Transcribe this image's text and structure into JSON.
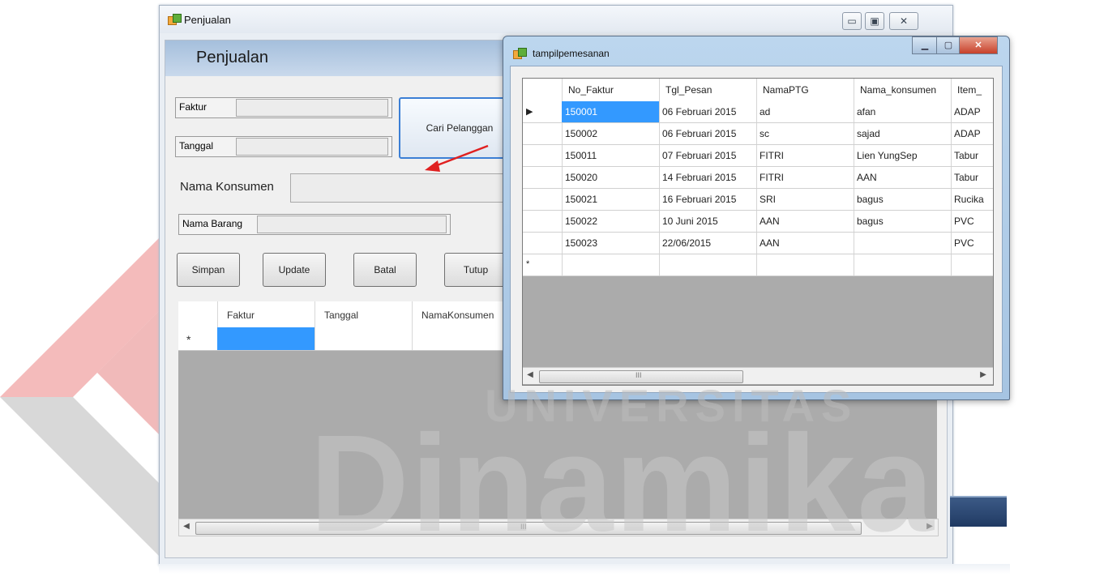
{
  "watermark": {
    "line1": "UNIVERSITAS",
    "line2": "Dinamika"
  },
  "main_window": {
    "title": "Penjualan",
    "header": "Penjualan",
    "controls": {
      "minimize": "▭",
      "maximize": "▣",
      "close": "✕"
    },
    "labels": {
      "faktur": "Faktur",
      "tanggal": "Tanggal",
      "nama_konsumen": "Nama Konsumen",
      "nama_barang": "Nama Barang"
    },
    "buttons": {
      "cari_pelanggan": "Cari Pelanggan",
      "simpan": "Simpan",
      "update": "Update",
      "batal": "Batal",
      "tutup": "Tutup"
    },
    "grid": {
      "columns": [
        "Faktur",
        "Tanggal",
        "NamaKonsumen"
      ],
      "new_row_marker": "*"
    },
    "scroll_mark": "III"
  },
  "popup_window": {
    "title": "tampilpemesanan",
    "columns": [
      "No_Faktur",
      "Tgl_Pesan",
      "NamaPTG",
      "Nama_konsumen",
      "Item_"
    ],
    "rows": [
      [
        "150001",
        "06 Februari 2015",
        "ad",
        "afan",
        "ADAP"
      ],
      [
        "150002",
        "06 Februari 2015",
        "sc",
        "sajad",
        "ADAP"
      ],
      [
        "150011",
        "07 Februari 2015",
        "FITRI",
        "Lien YungSep",
        "Tabur"
      ],
      [
        "150020",
        "14 Februari 2015",
        "FITRI",
        "AAN",
        "Tabur"
      ],
      [
        "150021",
        "16 Februari 2015",
        "SRI",
        "bagus",
        "Rucika"
      ],
      [
        "150022",
        "10 Juni 2015",
        "AAN",
        "bagus",
        "PVC"
      ],
      [
        "150023",
        "22/06/2015",
        "AAN",
        "",
        "PVC"
      ]
    ],
    "current_row_marker": "▶",
    "new_row_marker": "*",
    "scroll_mark": "III"
  },
  "annotation": {
    "arrow_color": "#e02020"
  },
  "colors": {
    "selection": "#3399ff",
    "header_band": "#b5cbe4",
    "grid_background": "#ababab"
  }
}
